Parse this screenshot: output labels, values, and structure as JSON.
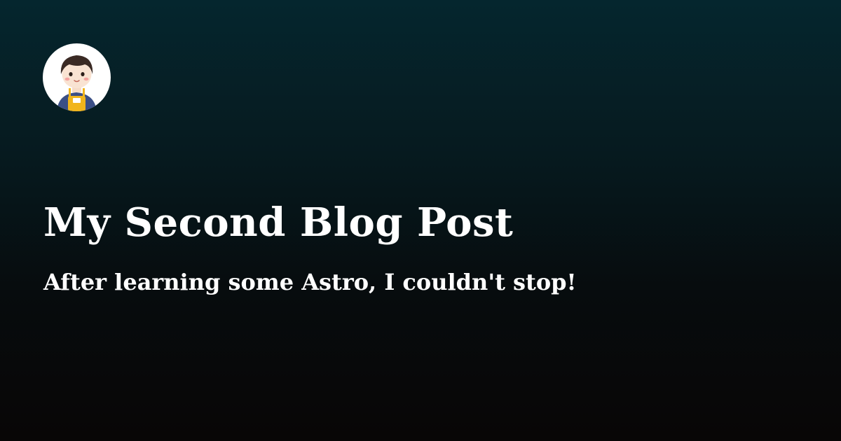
{
  "post": {
    "title": "My Second Blog Post",
    "description": "After learning some Astro, I couldn't stop!"
  },
  "author": {
    "avatar_icon": "cartoon-avatar-icon"
  },
  "colors": {
    "background_top": "#05262e",
    "background_bottom": "#080606",
    "text": "#ffffff",
    "avatar_background": "#ffffff"
  }
}
